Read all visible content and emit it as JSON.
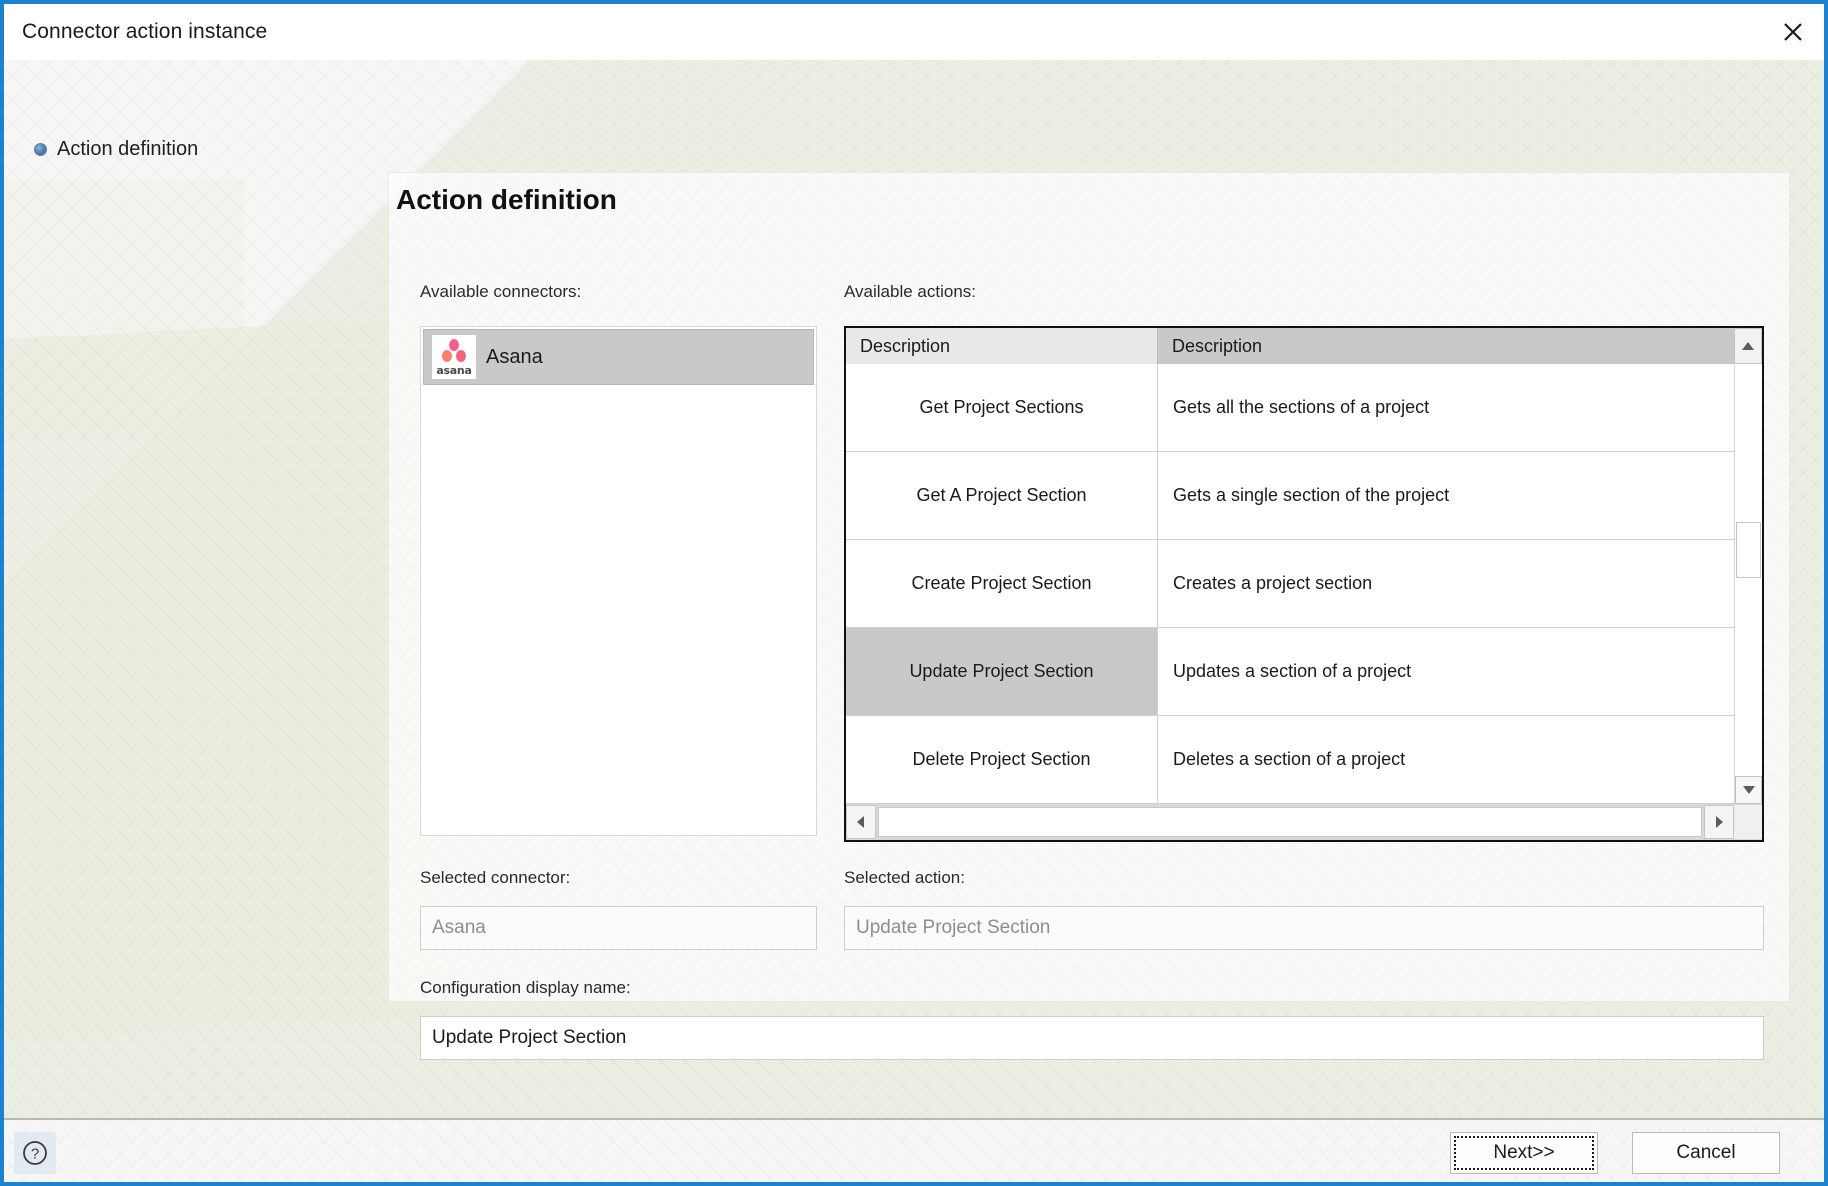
{
  "window": {
    "title": "Connector action instance",
    "close_icon": "close-icon",
    "accent_color": "#1b82d2"
  },
  "sidebar": {
    "items": [
      {
        "label": "Action definition",
        "bullet_icon": "bullet-dot-icon",
        "active": true
      }
    ]
  },
  "main": {
    "page_title": "Action definition",
    "labels": {
      "available_connectors": "Available connectors:",
      "available_actions": "Available actions:",
      "selected_connector": "Selected connector:",
      "selected_action": "Selected action:",
      "configuration_display_name": "Configuration display name:"
    },
    "connectors": [
      {
        "name": "Asana",
        "logo_icon": "asana-logo-icon",
        "wordmark": "asana",
        "selected": true
      }
    ],
    "actions_grid": {
      "columns": [
        "Description",
        "Description"
      ],
      "rows": [
        {
          "name": "Get Project Sections",
          "description": "Gets all the sections of a project",
          "selected": false
        },
        {
          "name": "Get A Project Section",
          "description": "Gets a single section of the project",
          "selected": false
        },
        {
          "name": "Create Project Section",
          "description": "Creates a project section",
          "selected": false
        },
        {
          "name": "Update Project Section",
          "description": "Updates a section of a project",
          "selected": true
        },
        {
          "name": "Delete Project Section",
          "description": "Deletes a section of a project",
          "selected": false
        }
      ],
      "scroll_up_icon": "triangle-up-icon",
      "scroll_down_icon": "triangle-down-icon",
      "scroll_left_icon": "triangle-left-icon",
      "scroll_right_icon": "triangle-right-icon"
    },
    "fields": {
      "selected_connector_value": "Asana",
      "selected_action_value": "Update Project Section",
      "configuration_display_name_value": "Update Project Section"
    }
  },
  "footer": {
    "help_icon": "question-mark-circle-icon",
    "next_label": "Next>>",
    "cancel_label": "Cancel"
  }
}
